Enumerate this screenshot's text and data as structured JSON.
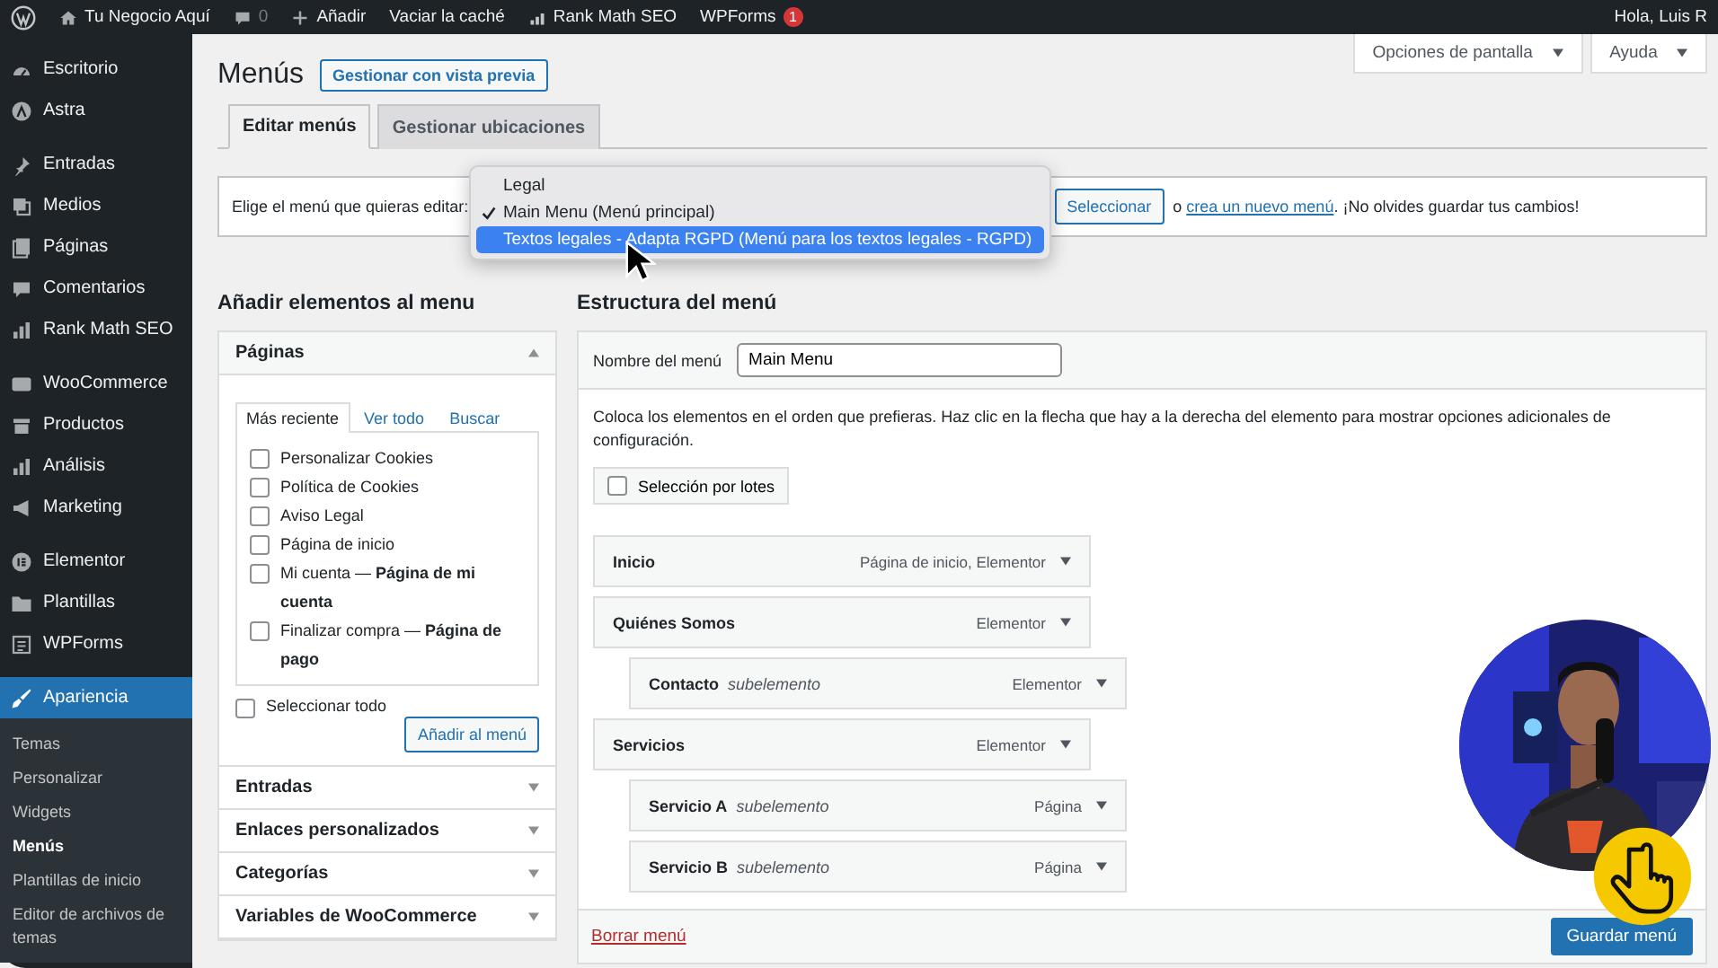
{
  "admin_bar": {
    "items": [
      {
        "kind": "logo"
      },
      {
        "kind": "home",
        "label": "Tu Negocio Aquí"
      },
      {
        "kind": "comments",
        "label": "0"
      },
      {
        "kind": "add",
        "label": "Añadir"
      },
      {
        "kind": "text",
        "label": "Vaciar la caché"
      },
      {
        "kind": "rankmath",
        "label": "Rank Math SEO"
      },
      {
        "kind": "text",
        "label": "WPForms",
        "badge": "1"
      }
    ],
    "greeting": "Hola, Luis R"
  },
  "sidebar": {
    "groups": [
      {
        "items": [
          {
            "kind": "dashboard",
            "label": "Escritorio",
            "selected": false
          },
          {
            "kind": "astra",
            "label": "Astra",
            "selected": false
          }
        ]
      },
      {
        "items": [
          {
            "kind": "pin",
            "label": "Entradas",
            "selected": false
          },
          {
            "kind": "media",
            "label": "Medios",
            "selected": false
          },
          {
            "kind": "pages",
            "label": "Páginas",
            "selected": false
          },
          {
            "kind": "comments",
            "label": "Comentarios",
            "selected": false
          },
          {
            "kind": "rankmath",
            "label": "Rank Math SEO",
            "selected": false
          }
        ]
      },
      {
        "items": [
          {
            "kind": "woo",
            "label": "WooCommerce",
            "selected": false
          },
          {
            "kind": "products",
            "label": "Productos",
            "selected": false
          },
          {
            "kind": "analytics",
            "label": "Análisis",
            "selected": false
          },
          {
            "kind": "megaphone",
            "label": "Marketing",
            "selected": false
          }
        ]
      },
      {
        "items": [
          {
            "kind": "elementor",
            "label": "Elementor",
            "selected": false
          },
          {
            "kind": "folder",
            "label": "Plantillas",
            "selected": false
          },
          {
            "kind": "forms",
            "label": "WPForms",
            "selected": false
          }
        ]
      },
      {
        "items": [
          {
            "kind": "brush",
            "label": "Apariencia",
            "selected": true
          }
        ]
      }
    ],
    "submenu": [
      {
        "label": "Temas",
        "selected": false
      },
      {
        "label": "Personalizar",
        "selected": false
      },
      {
        "label": "Widgets",
        "selected": false
      },
      {
        "label": "Menús",
        "selected": true
      },
      {
        "label": "Plantillas de inicio",
        "selected": false
      },
      {
        "label": "Editor de archivos de temas",
        "selected": false
      }
    ]
  },
  "screen_meta": [
    "Opciones de pantalla",
    "Ayuda"
  ],
  "page_title": "Menús",
  "title_action": "Gestionar con vista previa",
  "tabs": [
    {
      "label": "Editar menús",
      "selected": true
    },
    {
      "label": "Gestionar ubicaciones",
      "selected": false
    }
  ],
  "menu_select": {
    "label": "Elige el menú que quieras editar:",
    "button": "Seleccionar",
    "note_prefix": "o ",
    "note_link": "crea un nuevo menú",
    "note_suffix": ". ¡No olvides guardar tus cambios!",
    "options": [
      {
        "label": "Legal",
        "checked": false,
        "selected": false
      },
      {
        "label": "Main Menu (Menú principal)",
        "checked": true,
        "selected": false
      },
      {
        "label": "Textos legales - Adapta RGPD (Menú para los textos legales - RGPD)",
        "checked": false,
        "selected": true
      }
    ]
  },
  "add_items": {
    "heading": "Añadir elementos al menu",
    "panels": [
      {
        "title": "Páginas",
        "expanded": true,
        "tabs": [
          {
            "label": "Más reciente",
            "selected": true
          },
          {
            "label": "Ver todo",
            "selected": false
          },
          {
            "label": "Buscar",
            "selected": false
          }
        ],
        "items": [
          {
            "label": "Personalizar Cookies",
            "checked": false
          },
          {
            "label": "Política de Cookies",
            "checked": false
          },
          {
            "label": "Aviso Legal",
            "checked": false
          },
          {
            "label": "Página de inicio",
            "checked": false
          },
          {
            "label": "Mi cuenta — **Página de mi cuenta**",
            "checked": false
          },
          {
            "label": "Finalizar compra — **Página de pago**",
            "checked": false
          }
        ],
        "select_all": {
          "label": "Seleccionar todo",
          "checked": false
        },
        "button": "Añadir al menú"
      },
      {
        "title": "Entradas",
        "expanded": false
      },
      {
        "title": "Enlaces personalizados",
        "expanded": false
      },
      {
        "title": "Categorías",
        "expanded": false
      },
      {
        "title": "Variables de WooCommerce",
        "expanded": false
      }
    ]
  },
  "structure": {
    "heading": "Estructura del menú",
    "name_label": "Nombre del menú",
    "name_value": "Main Menu",
    "instructions": "Coloca los elementos en el orden que prefieras. Haz clic en la flecha que hay a la derecha del elemento para mostrar opciones adicionales de configuración.",
    "bulk": {
      "label": "Selección por lotes",
      "checked": false
    },
    "items": [
      {
        "title": "Inicio",
        "type": "Página de inicio, Elementor"
      },
      {
        "title": "Quiénes Somos",
        "type": "Elementor",
        "children": [
          {
            "title": "Contacto",
            "note": "subelemento",
            "type": "Elementor"
          }
        ]
      },
      {
        "title": "Servicios",
        "type": "Elementor",
        "children": [
          {
            "title": "Servicio A",
            "note": "subelemento",
            "type": "Página"
          },
          {
            "title": "Servicio B",
            "note": "subelemento",
            "type": "Página"
          }
        ]
      }
    ],
    "delete_link": "Borrar menú",
    "save_button": "Guardar menú"
  },
  "webcam": {
    "kind": "picture"
  }
}
